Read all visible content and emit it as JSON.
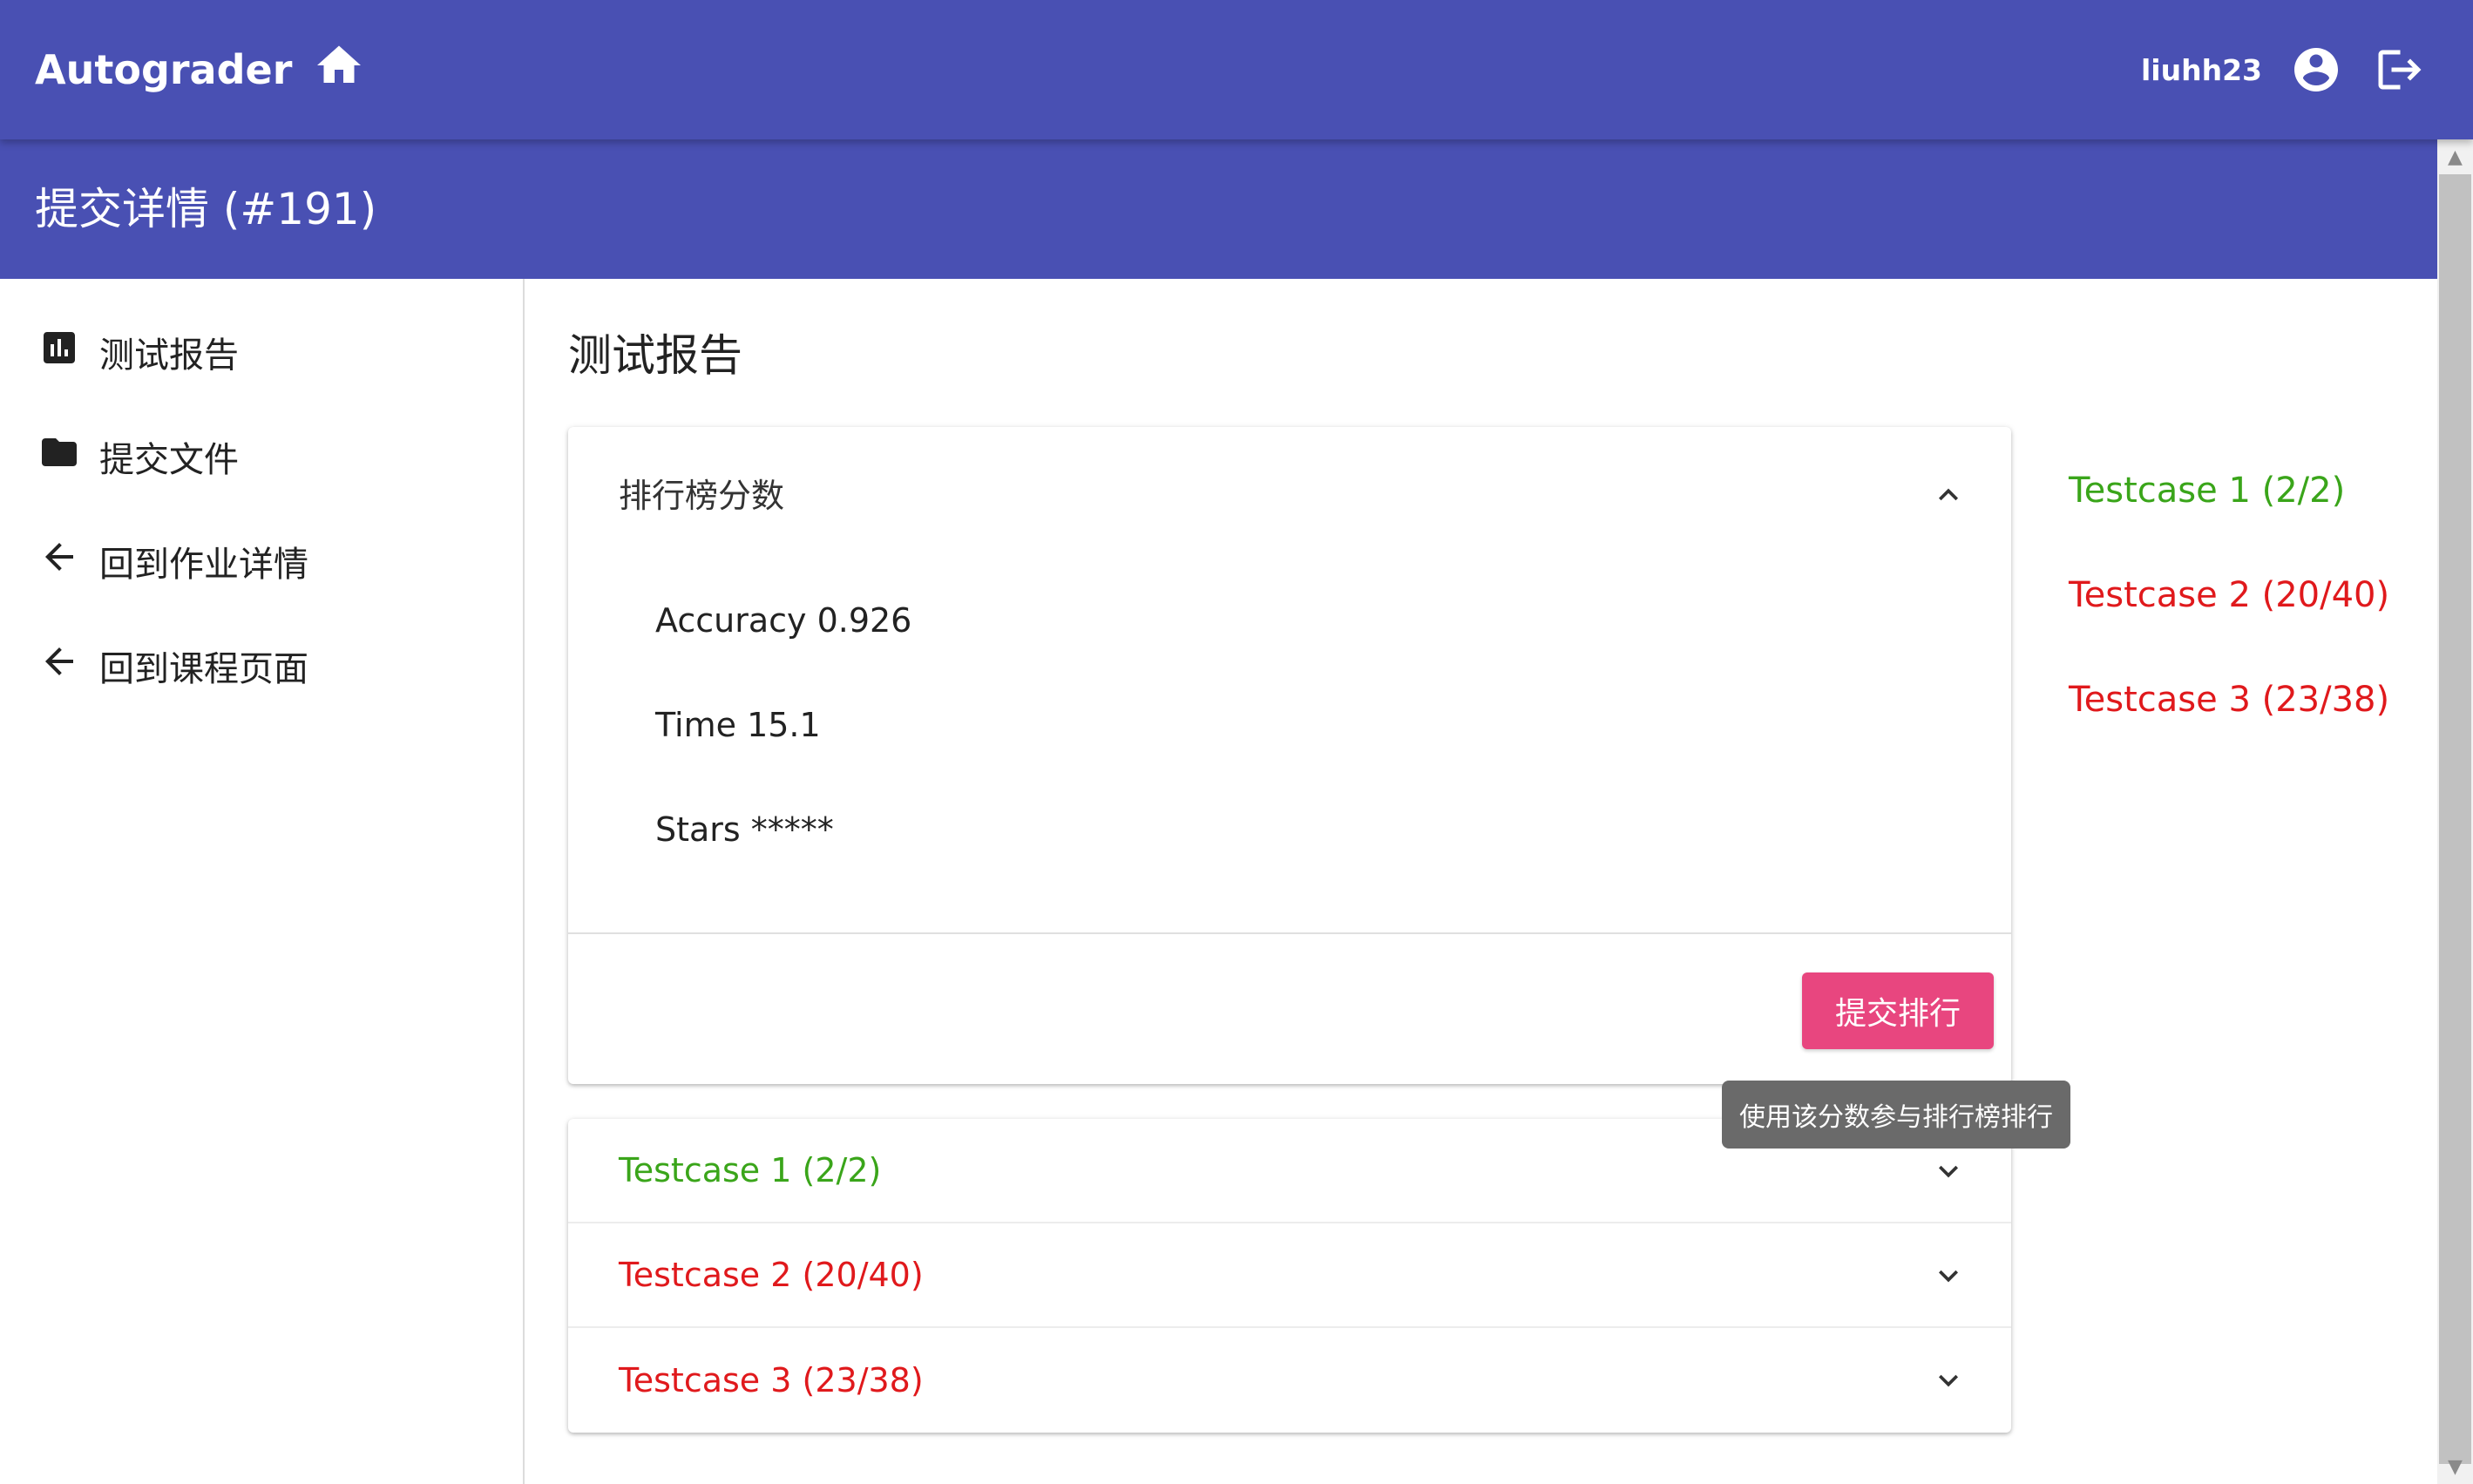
{
  "appbar": {
    "brand": "Autograder",
    "username": "liuhh23"
  },
  "page": {
    "title": "提交详情 (#191)"
  },
  "sidebar": {
    "items": [
      {
        "label": "测试报告",
        "icon": "bar-chart-icon"
      },
      {
        "label": "提交文件",
        "icon": "folder-icon"
      },
      {
        "label": "回到作业详情",
        "icon": "arrow-back-icon"
      },
      {
        "label": "回到课程页面",
        "icon": "arrow-back-icon"
      }
    ]
  },
  "main": {
    "section_title": "测试报告",
    "leaderboard": {
      "header": "排行榜分数",
      "metrics": [
        "Accuracy 0.926",
        "Time 15.1",
        "Stars *****"
      ],
      "submit_label": "提交排行",
      "tooltip": "使用该分数参与排行榜排行"
    },
    "testcases": [
      {
        "label": "Testcase 1 (2/2)",
        "status": "pass",
        "color": "#3aa51a"
      },
      {
        "label": "Testcase 2 (20/40)",
        "status": "fail",
        "color": "#e0191c"
      },
      {
        "label": "Testcase 3 (23/38)",
        "status": "fail",
        "color": "#e0191c"
      }
    ]
  },
  "colors": {
    "primary": "#4950b3",
    "accent": "#e8467f",
    "pass": "#3aa51a",
    "fail": "#e0191c"
  }
}
